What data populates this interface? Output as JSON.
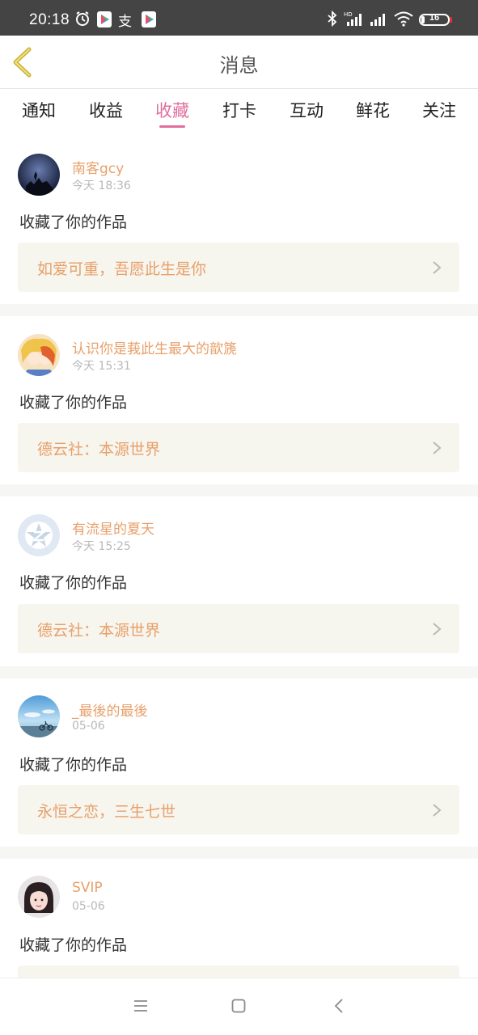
{
  "status_bar": {
    "time": "20:18",
    "battery": "16",
    "icons": [
      "alarm-icon",
      "play-store-icon",
      "zhifubao-icon",
      "play-store-icon",
      "bluetooth-icon",
      "hd-signal-icon",
      "signal-icon",
      "wifi-icon",
      "battery-icon"
    ]
  },
  "header": {
    "title": "消息",
    "back_icon": "chevron-left-icon"
  },
  "tabs": [
    {
      "label": "通知"
    },
    {
      "label": "收益"
    },
    {
      "label": "收藏"
    },
    {
      "label": "打卡"
    },
    {
      "label": "互动"
    },
    {
      "label": "鲜花"
    },
    {
      "label": "关注"
    }
  ],
  "active_tab": "收藏",
  "colors": {
    "accent": "#e06f9e",
    "username": "#e8a06a",
    "work_bg": "#f6f5ee",
    "status_bar": "#444444"
  },
  "messages": [
    {
      "user": "南客gcy",
      "time": "今天 18:36",
      "action": "收藏了你的作品",
      "work": "如爱可重，吾愿此生是你"
    },
    {
      "user": "认识你是莪此生最大的歆篪",
      "time": "今天 15:31",
      "action": "收藏了你的作品",
      "work": "德云社：本源世界"
    },
    {
      "user": "有流星的夏天",
      "time": "今天 15:25",
      "action": "收藏了你的作品",
      "work": "德云社：本源世界"
    },
    {
      "user": "_最後的最後",
      "time": "05-06",
      "action": "收藏了你的作品",
      "work": "永恒之恋，三生七世"
    },
    {
      "user": "SVIP",
      "time": "05-06",
      "action": "收藏了你的作品",
      "work": ""
    }
  ],
  "nav_bar": [
    "menu-icon",
    "home-square-icon",
    "back-triangle-icon"
  ]
}
